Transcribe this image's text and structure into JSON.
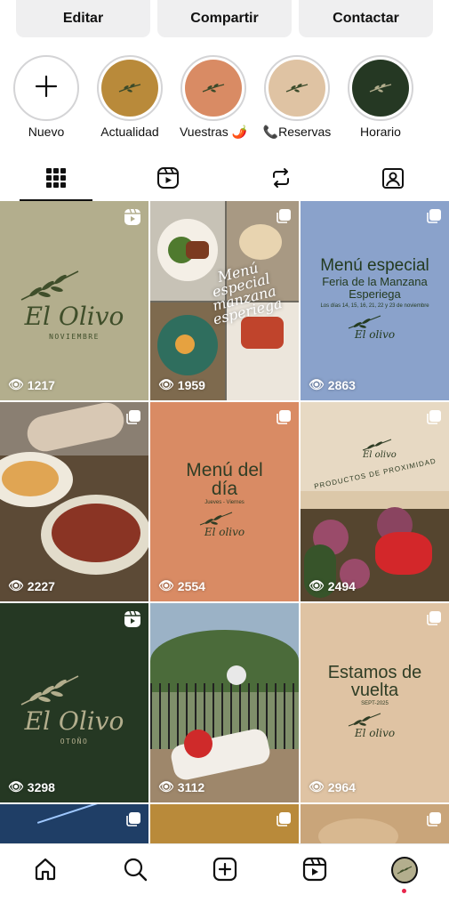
{
  "actions": {
    "edit": "Editar",
    "share": "Compartir",
    "contact": "Contactar"
  },
  "highlights": [
    {
      "label": "Nuevo",
      "color": "#ffffff",
      "icon": "plus-icon"
    },
    {
      "label": "Actualidad",
      "color": "#b98a3a",
      "icon": "olive-branch-icon"
    },
    {
      "label": "Vuestras 🌶️",
      "color": "#d98b64",
      "icon": "olive-branch-icon"
    },
    {
      "label": "📞Reservas",
      "color": "#dfc3a3",
      "icon": "olive-branch-icon"
    },
    {
      "label": "Horario",
      "color": "#253823",
      "icon": "olive-branch-icon"
    }
  ],
  "tabs": [
    "grid-icon",
    "reels-icon",
    "reposts-icon",
    "tagged-icon"
  ],
  "posts": [
    {
      "bg": "#b3ae8d",
      "brand": "El Olivo",
      "sub": "NOVIEMBRE",
      "views": "1217",
      "type": "reel"
    },
    {
      "bg": "#8f8a80",
      "script": "Menú especial manzana esperiega",
      "views": "1959",
      "type": "carousel"
    },
    {
      "bg": "#8aa2cb",
      "title": "Menú especial",
      "subtitle": "Feria de la Manzana Esperiega",
      "small": "Los días 14, 15, 16, 21, 22 y 23 de noviembre",
      "brand": "El olivo",
      "views": "2863",
      "type": "carousel"
    },
    {
      "bg": "#6b5a42",
      "views": "2227",
      "type": "carousel"
    },
    {
      "bg": "#d98b64",
      "title": "Menú del día",
      "small": "Jueves - Viernes",
      "brand": "El olivo",
      "views": "2554",
      "type": "carousel"
    },
    {
      "bg": "#dcc8a9",
      "curved": "PRODUCTOS DE PROXIMIDAD",
      "views": "2494",
      "type": "carousel"
    },
    {
      "bg": "#253823",
      "brand": "El Olivo",
      "sub": "OTOÑO",
      "views": "3298",
      "type": "reel"
    },
    {
      "bg": "#8f9a7a",
      "views": "3112",
      "type": "carousel"
    },
    {
      "bg": "#dfc3a3",
      "title": "Estamos de vuelta",
      "small": "SEPT-2025",
      "brand": "El olivo",
      "views": "2964",
      "type": "carousel"
    }
  ],
  "partial_posts": [
    {
      "bg": "#1f3e66",
      "type": "carousel"
    },
    {
      "bg": "#b98a3a",
      "type": "carousel"
    },
    {
      "bg": "#c9a57a",
      "type": "carousel"
    }
  ],
  "nav": [
    "home-icon",
    "search-icon",
    "create-icon",
    "reels-icon",
    "profile-avatar"
  ]
}
